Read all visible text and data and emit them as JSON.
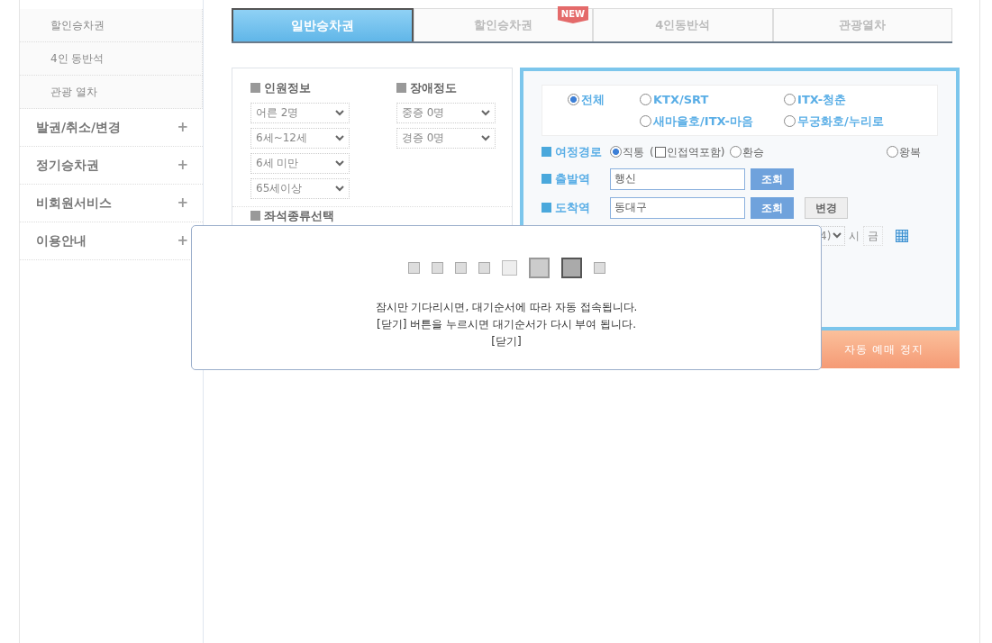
{
  "sidebar": {
    "items": [
      {
        "label": "할인승차권",
        "kind": "sub"
      },
      {
        "label": "4인 동반석",
        "kind": "sub"
      },
      {
        "label": "관광 열차",
        "kind": "sub"
      },
      {
        "label": "발권/취소/변경",
        "kind": "main",
        "toggle": "+"
      },
      {
        "label": "정기승차권",
        "kind": "main",
        "toggle": "+"
      },
      {
        "label": "비회원서비스",
        "kind": "main",
        "toggle": "+"
      },
      {
        "label": "이용안내",
        "kind": "main",
        "toggle": "+"
      }
    ]
  },
  "tabs": [
    {
      "label": "일반승차권",
      "selected": true
    },
    {
      "label": "할인승차권",
      "selected": false,
      "badge": "NEW"
    },
    {
      "label": "4인동반석",
      "selected": false
    },
    {
      "label": "관광열차",
      "selected": false
    }
  ],
  "passengers": {
    "title": "인원정보",
    "selects": [
      "어른 2명",
      "6세~12세",
      "6세 미만",
      "65세이상"
    ]
  },
  "disability": {
    "title": "장애정도",
    "selects": [
      "중증 0명",
      "경증 0명"
    ]
  },
  "seat_section": {
    "title": "좌석종류선택"
  },
  "train_types": [
    {
      "label": "전체",
      "selected": true
    },
    {
      "label": "KTX/SRT",
      "selected": false
    },
    {
      "label": "ITX-청춘",
      "selected": false
    },
    {
      "label": "새마을호/ITX-마음",
      "selected": false
    },
    {
      "label": "무궁화호/누리로",
      "selected": false
    }
  ],
  "route": {
    "title": "여정경로",
    "options": [
      {
        "label": "직통",
        "selected": true
      },
      {
        "label": "환승",
        "selected": false
      },
      {
        "label": "왕복",
        "selected": false
      }
    ],
    "adjacent": {
      "open": "(",
      "label": "인접역포함)",
      "checked": false
    }
  },
  "departure": {
    "title": "출발역",
    "value": "행신",
    "button": "조회"
  },
  "arrival": {
    "title": "도착역",
    "value": "동대구",
    "button": "조회",
    "swap_button": "변경"
  },
  "date_row": {
    "hour_select": "4)",
    "hour_unit": "시",
    "weekday": "금"
  },
  "auto_button": "자동 예매 정지",
  "modal": {
    "squares": [
      {
        "kind": "normal"
      },
      {
        "kind": "normal"
      },
      {
        "kind": "normal"
      },
      {
        "kind": "normal"
      },
      {
        "kind": "faint"
      },
      {
        "kind": "big"
      },
      {
        "kind": "bigdark"
      },
      {
        "kind": "normal"
      }
    ],
    "lines": [
      "잠시만 기다리시면, 대기순서에 따라 자동 접속됩니다.",
      "[닫기] 버튼을 누르시면 대기순서가 다시 부여 됩니다."
    ],
    "close": "[닫기]"
  }
}
